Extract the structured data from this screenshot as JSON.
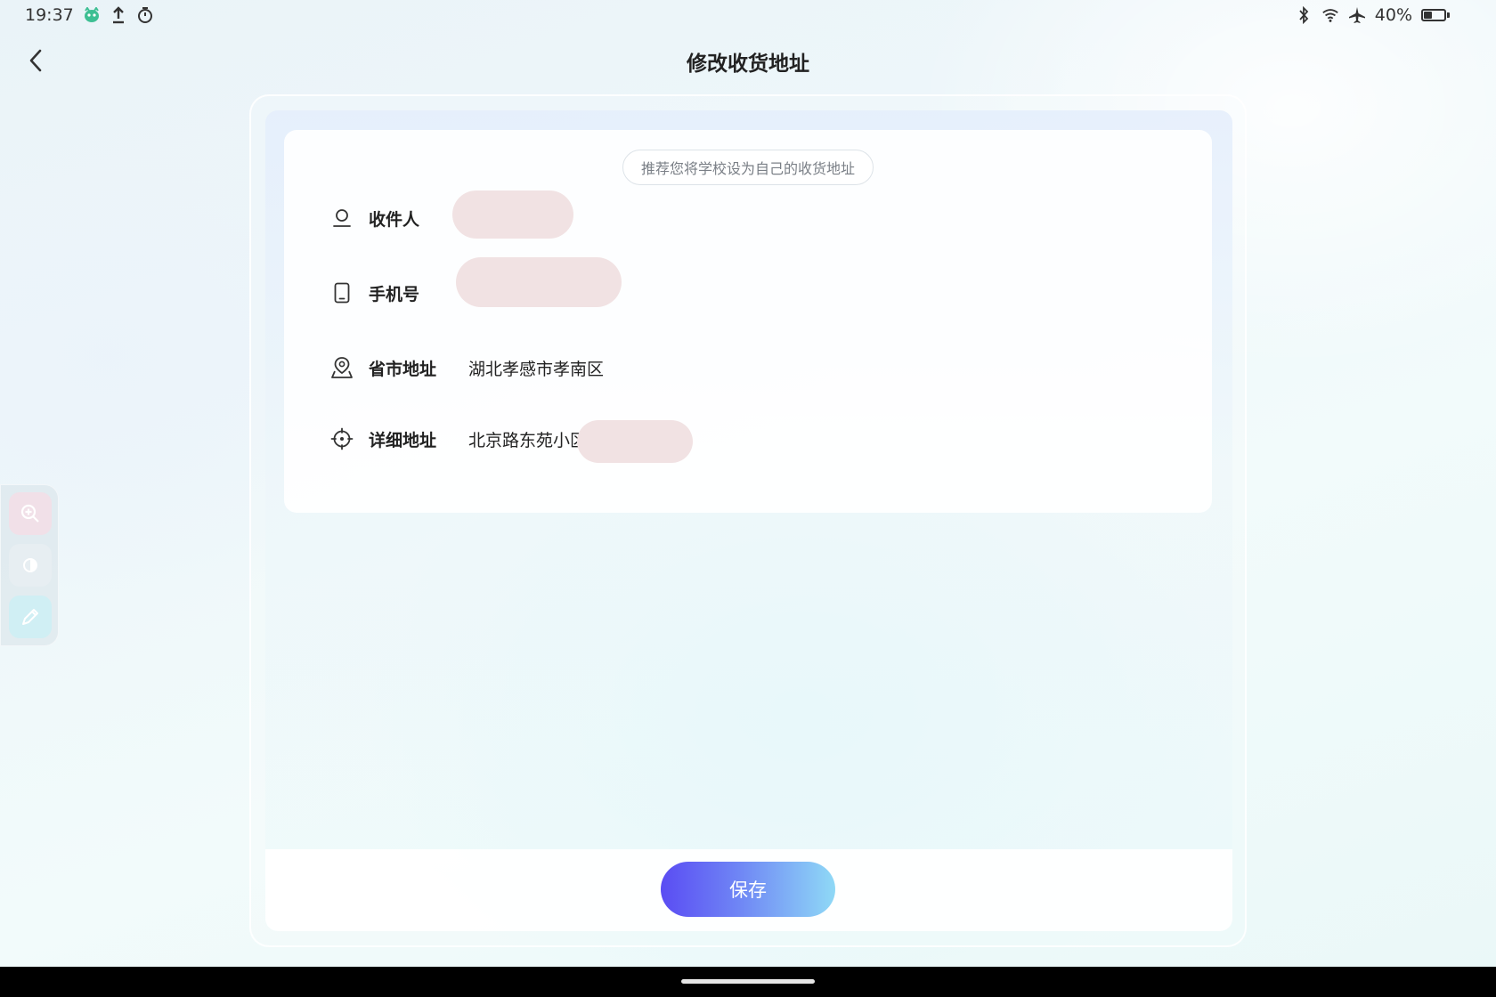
{
  "status_bar": {
    "time": "19:37",
    "left_icons": [
      "app-mascot-icon",
      "upload-icon",
      "timer-icon"
    ],
    "right_icons": [
      "bluetooth-icon",
      "wifi-icon",
      "airplane-mode-icon"
    ],
    "battery_percent_label": "40%",
    "battery_level": 0.4
  },
  "header": {
    "title": "修改收货地址",
    "back_icon": "chevron-left-icon"
  },
  "side_toolbar": {
    "tools": [
      "zoom-in-icon",
      "contrast-icon",
      "pen-icon"
    ]
  },
  "form": {
    "hint": "推荐您将学校设为自己的收货地址",
    "recipient": {
      "label": "收件人",
      "value": "",
      "icon": "person-icon"
    },
    "phone": {
      "label": "手机号",
      "value": "",
      "icon": "phone-icon"
    },
    "region": {
      "label": "省市地址",
      "value": "湖北孝感市孝南区",
      "icon": "map-pin-icon"
    },
    "detail": {
      "label": "详细地址",
      "value": "北京路东苑小区",
      "icon": "locate-icon"
    }
  },
  "actions": {
    "save_label": "保存"
  },
  "colors": {
    "save_gradient_start": "#5a4cf3",
    "save_gradient_end": "#8fd9f6",
    "redaction": "#f1e2e3"
  }
}
